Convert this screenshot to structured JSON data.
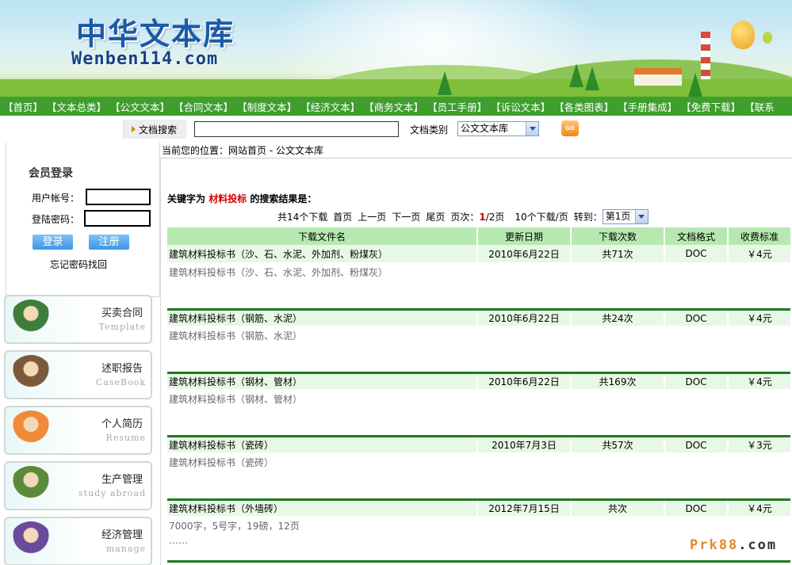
{
  "site": {
    "logo_cn": "中华文本库",
    "logo_en": "Wenben114.com"
  },
  "nav": [
    "【首页】",
    "【文本总类】",
    "【公文文本】",
    "【合同文本】",
    "【制度文本】",
    "【经济文本】",
    "【商务文本】",
    "【员工手册】",
    "【诉讼文本】",
    "【各类图表】",
    "【手册集成】",
    "【免费下载】",
    "【联系"
  ],
  "search": {
    "label": "文档搜索",
    "input_value": "",
    "type_label": "文档类别",
    "type_selected": "公文文本库",
    "go_label": "GO"
  },
  "breadcrumb": "当前您的位置：网站首页 - 公文文本库",
  "login": {
    "title": "会员登录",
    "account_label": "用户帐号：",
    "password_label": "登陆密码：",
    "login_button": "登录",
    "register_button": "注册",
    "forgot": "忘记密码找回"
  },
  "categories": [
    {
      "title": "买卖合同",
      "sub": "Template",
      "art_color": "#3f7d3a"
    },
    {
      "title": "述职报告",
      "sub": "CaseBook",
      "art_color": "#7a5a3a"
    },
    {
      "title": "个人简历",
      "sub": "Resume",
      "art_color": "#f08a3a"
    },
    {
      "title": "生产管理",
      "sub": "study abroad",
      "art_color": "#5a8a3a"
    },
    {
      "title": "经济管理",
      "sub": "manage",
      "art_color": "#6a4a9a"
    }
  ],
  "results": {
    "keyword_prefix": "关键字为",
    "keyword": "材料投标",
    "keyword_suffix": "的搜索结果是：",
    "pager": {
      "total": "共14个下载",
      "first": "首页",
      "prev": "上一页",
      "next": "下一页",
      "last": "尾页",
      "page_label": "页次：",
      "current": "1",
      "of": "/2页",
      "per_page": "10个下载/页",
      "goto": "转到：",
      "goto_selected": "第1页"
    },
    "columns": [
      "下载文件名",
      "更新日期",
      "下载次数",
      "文档格式",
      "收费标准"
    ],
    "items": [
      {
        "name": "建筑材料投标书（沙、石、水泥、外加剂、粉煤灰）",
        "date": "2010年6月22日",
        "downloads": "共71次",
        "format": "DOC",
        "price": "￥4元",
        "desc": [
          "建筑材料投标书（沙、石、水泥、外加剂、粉煤灰）"
        ]
      },
      {
        "name": "建筑材料投标书（钢筋、水泥）",
        "date": "2010年6月22日",
        "downloads": "共24次",
        "format": "DOC",
        "price": "￥4元",
        "desc": [
          "建筑材料投标书（钢筋、水泥）"
        ]
      },
      {
        "name": "建筑材料投标书（钢材、管材）",
        "date": "2010年6月22日",
        "downloads": "共169次",
        "format": "DOC",
        "price": "￥4元",
        "desc": [
          "建筑材料投标书（钢材、管材）"
        ]
      },
      {
        "name": "建筑材料投标书（瓷砖）",
        "date": "2010年7月3日",
        "downloads": "共57次",
        "format": "DOC",
        "price": "￥3元",
        "desc": [
          "建筑材料投标书（瓷砖）"
        ]
      },
      {
        "name": "建筑材料投标书（外墙砖）",
        "date": "2012年7月15日",
        "downloads": "共次",
        "format": "DOC",
        "price": "￥4元",
        "desc": [
          "7000字，5号字，19磅，12页",
          "……"
        ]
      }
    ]
  },
  "watermark": {
    "orange": "Prk88",
    "dark": ".com"
  }
}
